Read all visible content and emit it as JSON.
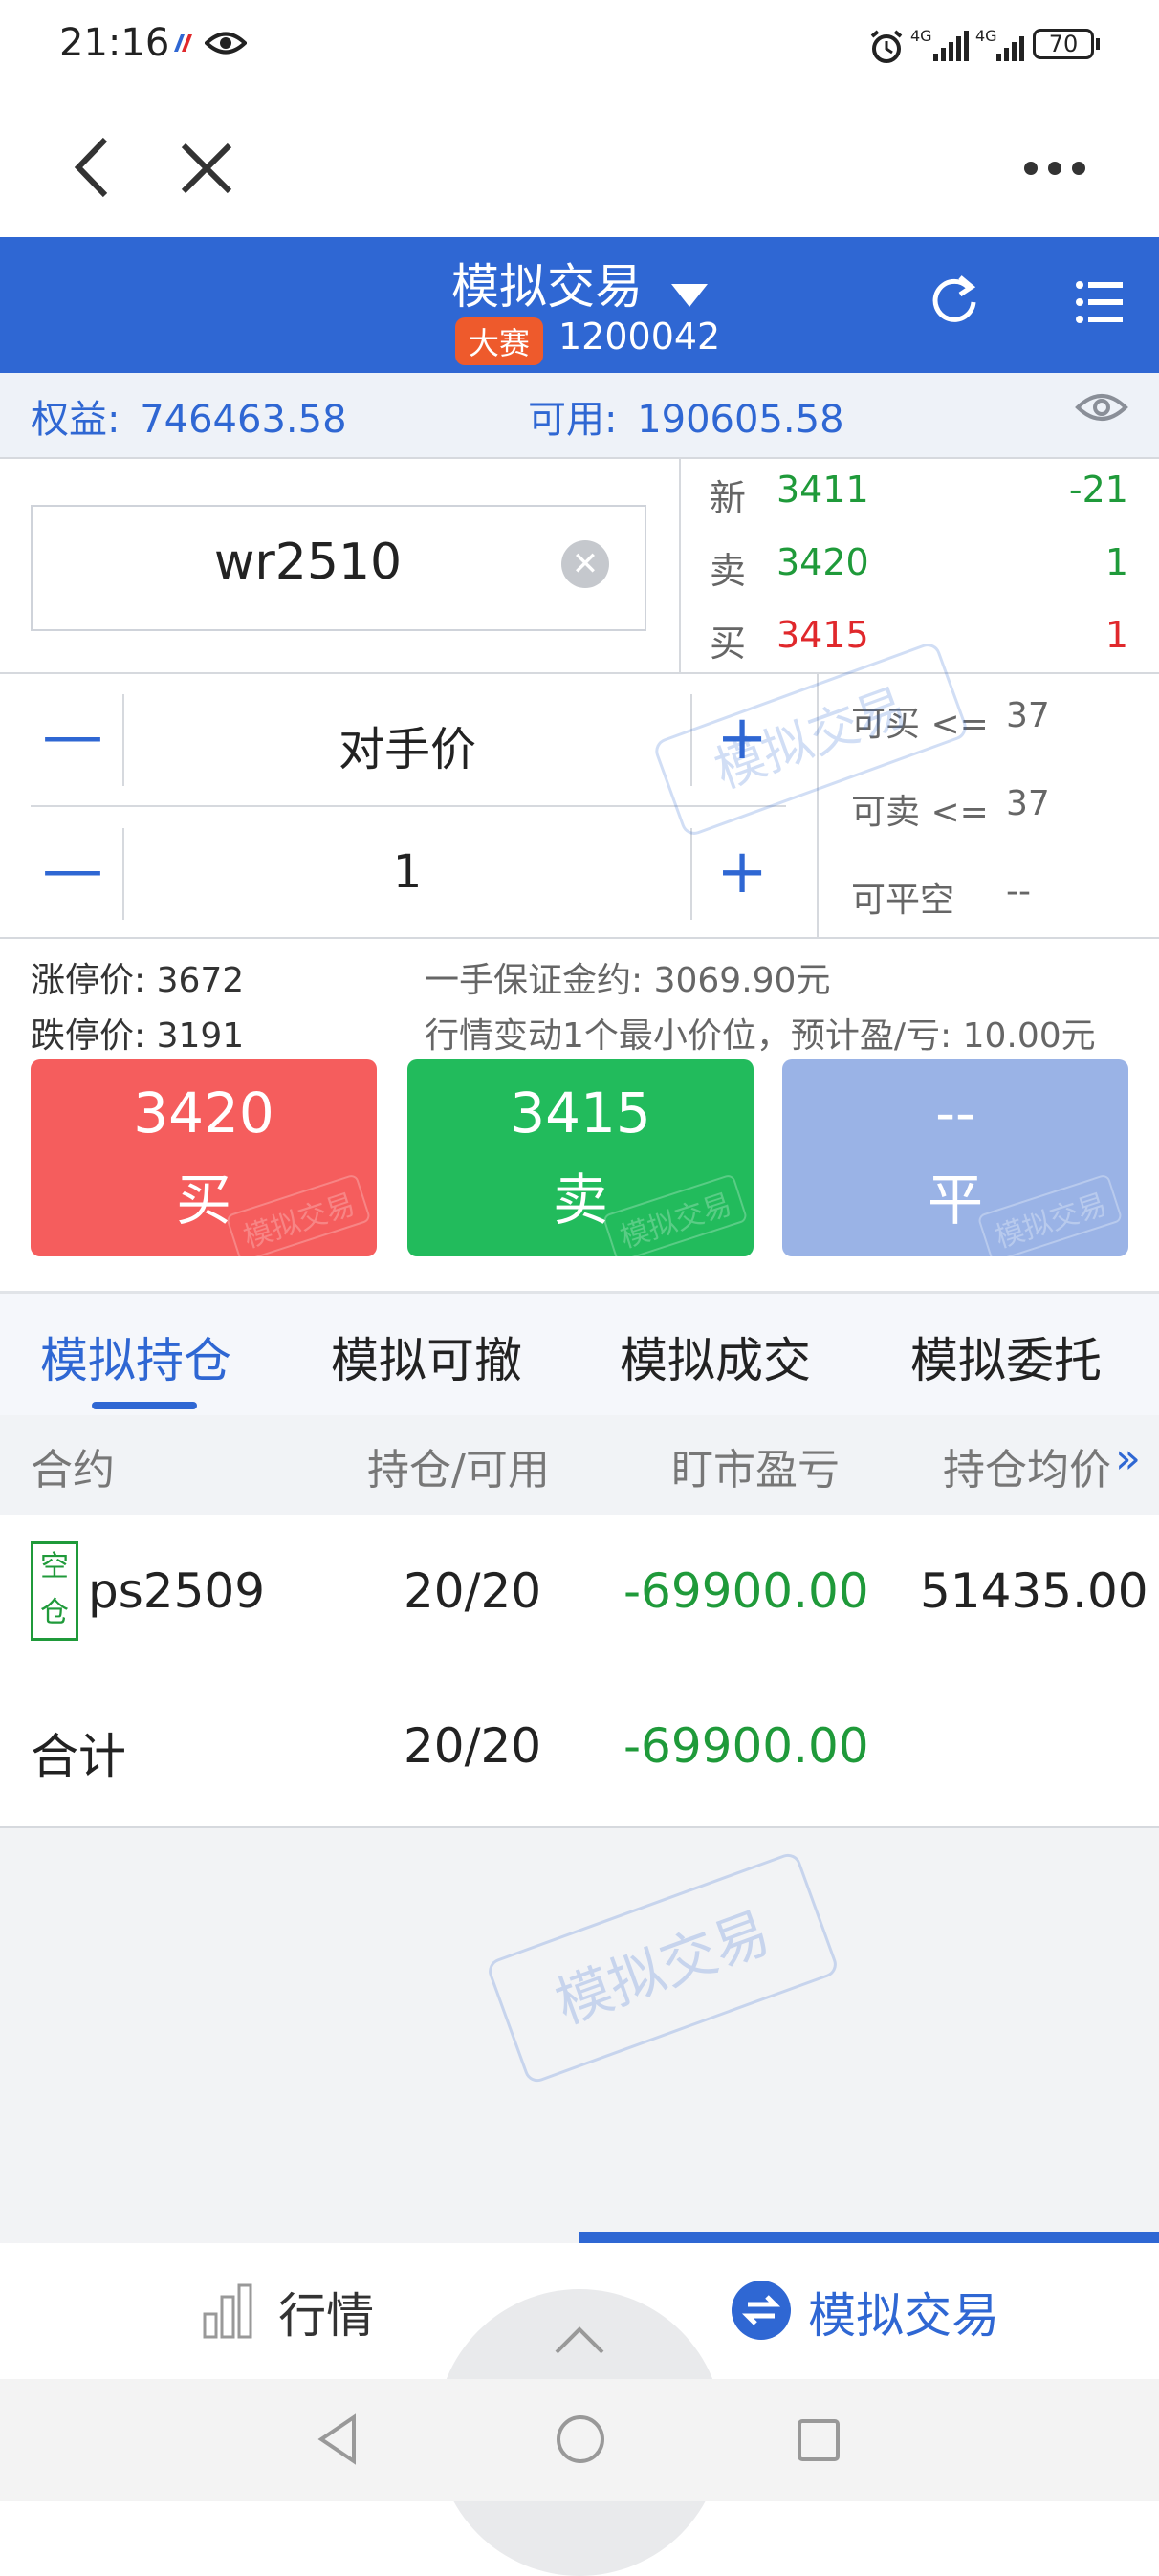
{
  "status_bar": {
    "time": "21:16",
    "net_label_1": "4G",
    "net_label_2": "4G",
    "battery": "70"
  },
  "header": {
    "title": "模拟交易",
    "badge": "大赛",
    "account": "1200042"
  },
  "account_summary": {
    "equity_label": "权益:",
    "equity_value": "746463.58",
    "available_label": "可用:",
    "available_value": "190605.58"
  },
  "contract": {
    "code": "wr2510"
  },
  "quote": {
    "rows": [
      {
        "label": "新",
        "price": "3411",
        "vol": "-21"
      },
      {
        "label": "卖",
        "price": "3420",
        "vol": "1"
      },
      {
        "label": "买",
        "price": "3415",
        "vol": "1"
      }
    ]
  },
  "order": {
    "price_mode": "对手价",
    "quantity": "1",
    "minus": "—",
    "plus": "+"
  },
  "capacity": {
    "buy_label": "可买 <=",
    "buy_value": "37",
    "sell_label": "可卖 <=",
    "sell_value": "37",
    "close_label": "可平空",
    "close_value": "--"
  },
  "limits": {
    "up_limit": "涨停价: 3672",
    "down_limit": "跌停价: 3191",
    "margin": "一手保证金约: 3069.90元",
    "tick_pl": "行情变动1个最小价位，预计盈/亏: 10.00元"
  },
  "actions": {
    "buy_price": "3420",
    "buy_label": "买",
    "sell_price": "3415",
    "sell_label": "卖",
    "close_price": "--",
    "close_label": "平",
    "watermark": "模拟交易"
  },
  "tabs": [
    "模拟持仓",
    "模拟可撤",
    "模拟成交",
    "模拟委托"
  ],
  "positions": {
    "headers": [
      "合约",
      "持仓/可用",
      "盯市盈亏",
      "持仓均价"
    ],
    "rows": [
      {
        "tag_top": "空",
        "tag_bottom": "仓",
        "contract": "ps2509",
        "qty": "20/20",
        "pnl": "-69900.00",
        "avg": "51435.00"
      }
    ],
    "total_label": "合计",
    "total_qty": "20/20",
    "total_pnl": "-69900.00"
  },
  "watermark_text": "模拟交易",
  "bottom_nav": {
    "market": "行情",
    "trade": "模拟交易"
  },
  "colors": {
    "brand_blue": "#2f67d3",
    "buy_red": "#f55d5d",
    "sell_green": "#22bb5c",
    "close_blue": "#9ab3e6"
  }
}
